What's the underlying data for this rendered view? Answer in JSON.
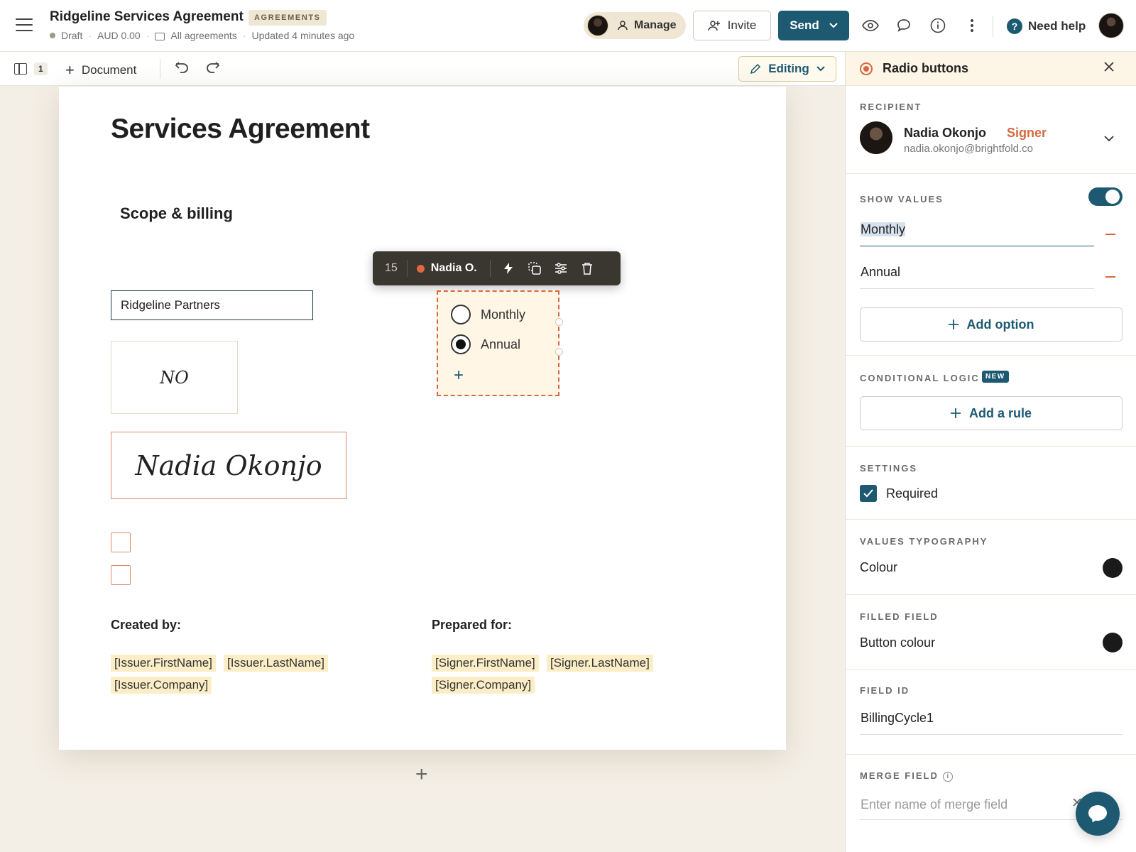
{
  "header": {
    "title": "Ridgeline Services Agreement",
    "badge": "AGREEMENTS",
    "status": "Draft",
    "amount": "AUD 0.00",
    "folder": "All agreements",
    "updated": "Updated 4 minutes ago",
    "manage_label": "Manage",
    "invite_label": "Invite",
    "send_label": "Send",
    "help_label": "Need help"
  },
  "toolbar": {
    "page_count": "1",
    "add_document_label": "Document",
    "mode_label": "Editing"
  },
  "document": {
    "title": "Services Agreement",
    "section_heading": "Scope & billing",
    "text_field_value": "Ridgeline Partners",
    "initials": "NO",
    "signature": "Nadia Okonjo",
    "created_by_label": "Created by:",
    "prepared_for_label": "Prepared for:",
    "issuer_fields": [
      "[Issuer.FirstName]",
      "[Issuer.LastName]",
      "[Issuer.Company]"
    ],
    "signer_fields": [
      "[Signer.FirstName]",
      "[Signer.LastName]",
      "[Signer.Company]"
    ]
  },
  "field_toolbar": {
    "number": "15",
    "assignee": "Nadia O."
  },
  "radio_group": {
    "options": [
      "Monthly",
      "Annual"
    ],
    "selected": "Annual"
  },
  "panel": {
    "title": "Radio buttons",
    "recipient_label": "RECIPIENT",
    "recipient_name": "Nadia Okonjo",
    "recipient_role": "Signer",
    "recipient_email": "nadia.okonjo@brightfold.co",
    "show_values_label": "SHOW VALUES",
    "show_values_on": true,
    "options": [
      "Monthly",
      "Annual"
    ],
    "add_option_label": "Add option",
    "conditional_logic_label": "CONDITIONAL LOGIC",
    "new_badge": "NEW",
    "add_rule_label": "Add a rule",
    "settings_label": "SETTINGS",
    "required_label": "Required",
    "required_checked": true,
    "values_typography_label": "VALUES TYPOGRAPHY",
    "colour_label": "Colour",
    "colour_value": "#1a1a1a",
    "filled_field_label": "FILLED FIELD",
    "button_colour_label": "Button colour",
    "button_colour_value": "#1a1a1a",
    "field_id_label": "FIELD ID",
    "field_id_value": "BillingCycle1",
    "merge_field_label": "MERGE FIELD",
    "merge_field_placeholder": "Enter name of merge field"
  },
  "colors": {
    "accent": "#1d5a72",
    "signer": "#d7683f",
    "merge_highlight": "#fbeec6"
  },
  "icons": [
    "menu-icon",
    "folder-icon",
    "people-icon",
    "add-person-icon",
    "chevron-down-icon",
    "eye-icon",
    "comment-icon",
    "info-icon",
    "kebab-icon",
    "help-icon",
    "pages-icon",
    "plus-icon",
    "undo-icon",
    "redo-icon",
    "pencil-icon",
    "lightning-icon",
    "copy-icon",
    "sliders-icon",
    "trash-icon",
    "radio-icon",
    "close-icon",
    "check-icon",
    "chat-icon"
  ]
}
